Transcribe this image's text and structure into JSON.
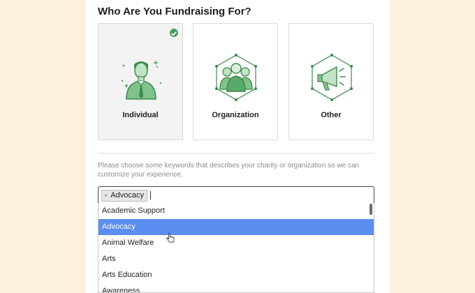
{
  "page": {
    "title": "Who Are You Fundraising For?",
    "helper_text": "Please choose some keywords that describes your charity or organization so we can customize your experience."
  },
  "cards": [
    {
      "label": "Individual",
      "icon": "person-icon",
      "selected": true
    },
    {
      "label": "Organization",
      "icon": "group-icon",
      "selected": false
    },
    {
      "label": "Other",
      "icon": "megaphone-icon",
      "selected": false
    }
  ],
  "keywords": {
    "selected_tags": [
      "Advocacy"
    ],
    "remove_glyph": "×",
    "options": [
      "Academic Support",
      "Advocacy",
      "Animal Welfare",
      "Arts",
      "Arts Education",
      "Awareness"
    ],
    "highlighted": "Advocacy"
  },
  "colors": {
    "background": "#fdf0dd",
    "accent_green": "#4e9a5d",
    "highlight_blue": "#5a8ef0"
  }
}
